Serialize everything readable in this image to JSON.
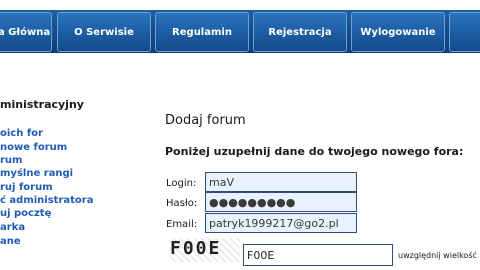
{
  "nav": {
    "items": [
      {
        "label": "a Główna"
      },
      {
        "label": "O Serwisie"
      },
      {
        "label": "Regulamin"
      },
      {
        "label": "Rejestracja"
      },
      {
        "label": "Wylogowanie"
      },
      {
        "label": ""
      }
    ]
  },
  "sidebar": {
    "title": "ministracyjny",
    "links": [
      {
        "label": "oich for"
      },
      {
        "label": "nowe forum"
      },
      {
        "label": "rum"
      },
      {
        "label": "myślne rangi"
      },
      {
        "label": "ruj forum"
      },
      {
        "label": "ć administratora"
      },
      {
        "label": "uj pocztę"
      },
      {
        "label": "arka"
      },
      {
        "label": "ane"
      }
    ]
  },
  "main": {
    "title": "Dodaj forum",
    "intro": "Poniżej uzupełnij dane do twojego nowego fora:",
    "form": {
      "login_label": "Login:",
      "login_value": "maV",
      "password_label": "Hasło:",
      "password_value": "●●●●●●●●●",
      "email_label": "Email:",
      "email_value": "patryk1999217@go2.pl",
      "captcha_text": "F00E",
      "captcha_value": "F00E",
      "case_note": "uwzględnij wielkość"
    }
  },
  "colors": {
    "nav_background": "#0e3f76",
    "nav_button": "#2a73bf",
    "link": "#1f5bb5",
    "input_background": "#e9f2fc"
  }
}
